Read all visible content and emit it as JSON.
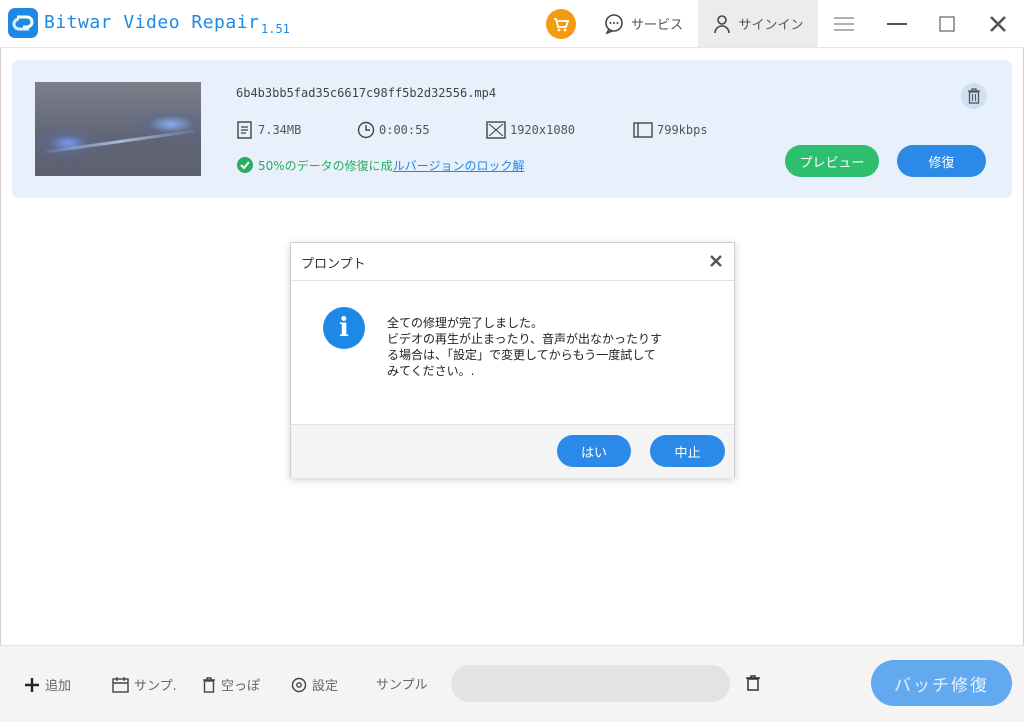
{
  "app": {
    "title": "Bitwar Video Repair",
    "version": "1.51"
  },
  "titlebar": {
    "service_label": "サービス",
    "signin_label": "サインイン"
  },
  "file": {
    "name": "6b4b3bb5fad35c6617c98ff5b2d32556.mp4",
    "size": "7.34MB",
    "duration": "0:00:55",
    "resolution": "1920x1080",
    "bitrate": "799kbps",
    "status_text": "50%のデータの修復に成",
    "unlock_text": "ルバージョンのロック解",
    "preview_label": "プレビュー",
    "repair_label": "修復"
  },
  "dialog": {
    "title": "プロンプト",
    "message_lines": [
      "全ての修理が完了しました。",
      "ビデオの再生が止まったり、音声が出なかったりす",
      "る場合は、「設定」で変更してからもう一度試して",
      "みてください。."
    ],
    "yes_label": "はい",
    "cancel_label": "中止"
  },
  "bottombar": {
    "add_label": "追加",
    "sample_short_label": "サンプ.",
    "empty_label": "空っぽ",
    "settings_label": "設定",
    "sample_label": "サンプル",
    "batch_label": "バッチ修復"
  },
  "colors": {
    "accent": "#1e88e5",
    "green": "#2dbf6e",
    "cart": "#f39c12"
  }
}
